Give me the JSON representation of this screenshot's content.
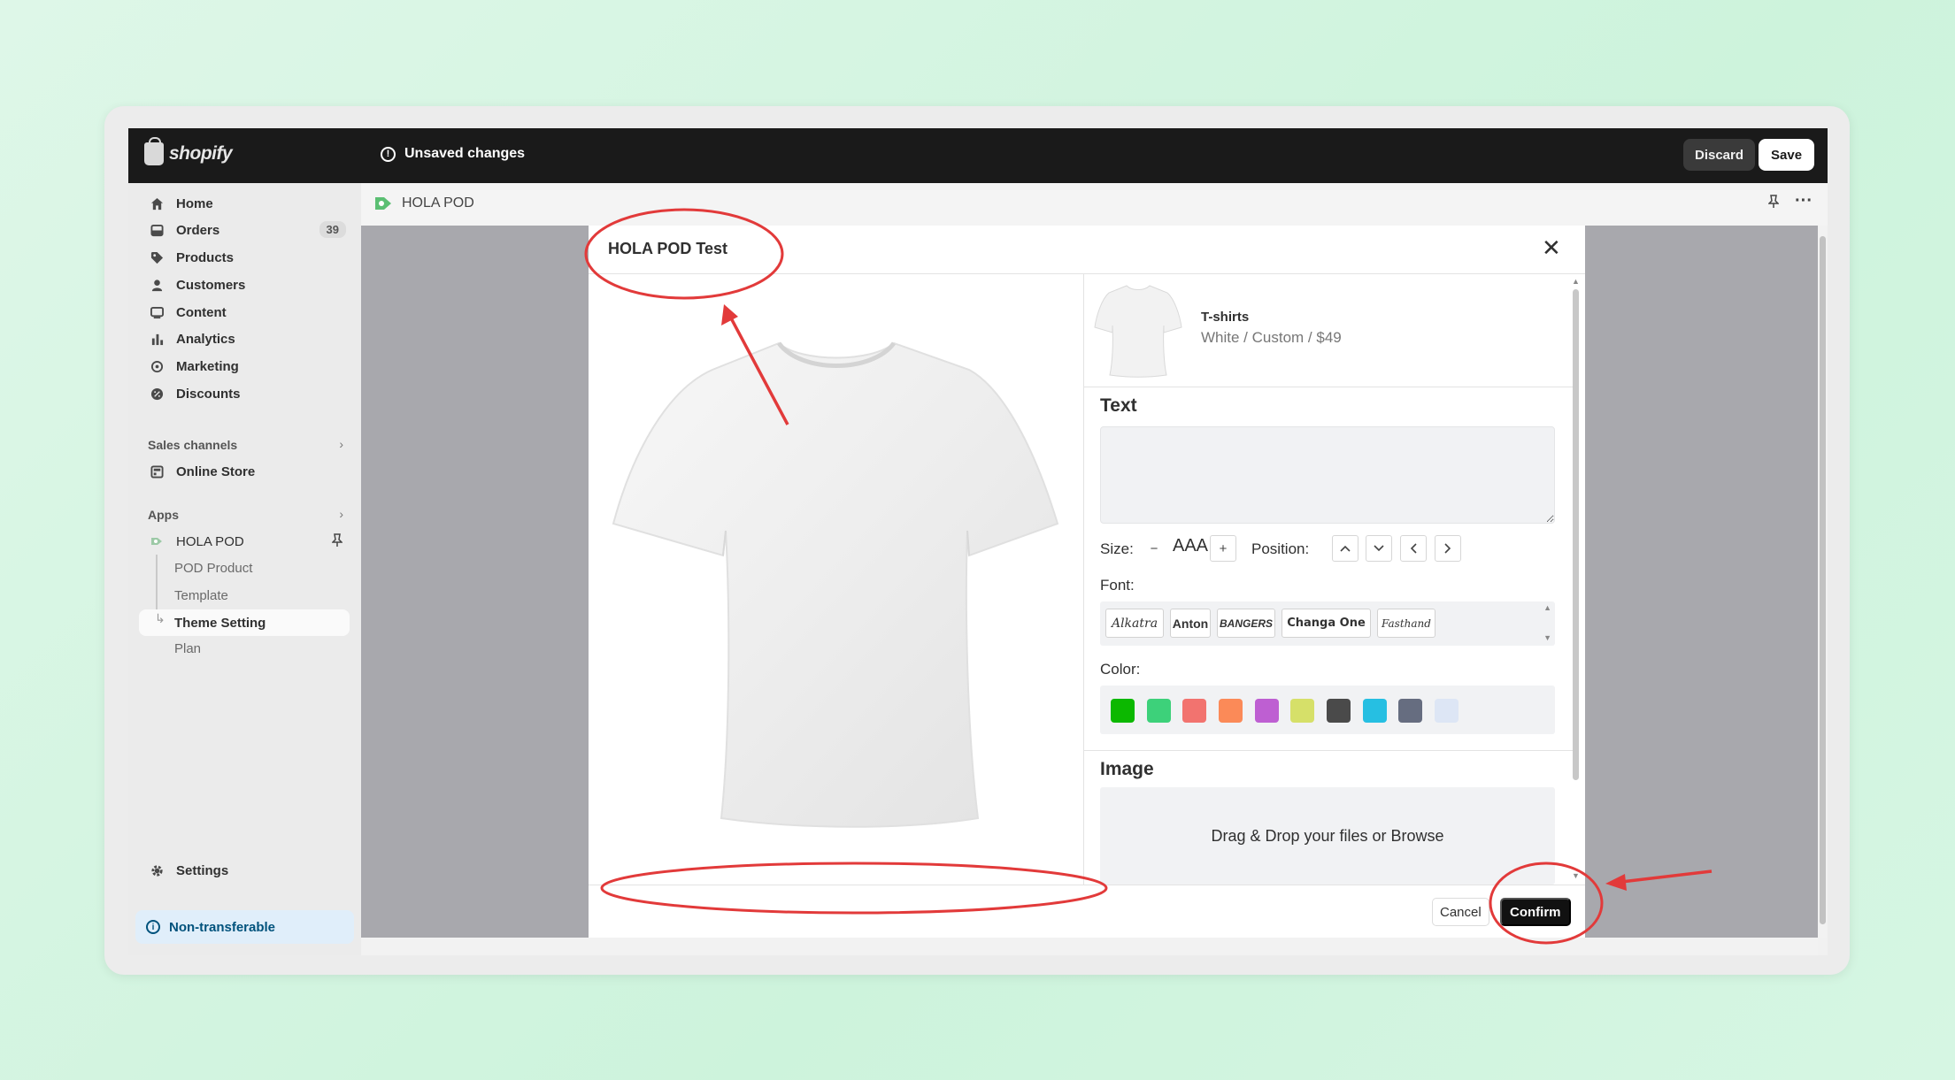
{
  "topbar": {
    "logo_text": "shopify",
    "status_text": "Unsaved changes",
    "discard_label": "Discard",
    "save_label": "Save"
  },
  "sidebar": {
    "items": [
      {
        "label": "Home",
        "icon": "home-icon"
      },
      {
        "label": "Orders",
        "icon": "inbox-icon",
        "badge": "39"
      },
      {
        "label": "Products",
        "icon": "tag-icon"
      },
      {
        "label": "Customers",
        "icon": "person-icon"
      },
      {
        "label": "Content",
        "icon": "image-icon"
      },
      {
        "label": "Analytics",
        "icon": "bar-chart-icon"
      },
      {
        "label": "Marketing",
        "icon": "target-icon"
      },
      {
        "label": "Discounts",
        "icon": "discount-icon"
      }
    ],
    "sales_channels_label": "Sales channels",
    "online_store_label": "Online Store",
    "apps_label": "Apps",
    "app_name": "HOLA POD",
    "app_sub_items": [
      "POD Product",
      "Template",
      "Theme Setting",
      "Plan"
    ],
    "settings_label": "Settings",
    "non_transferable_label": "Non-transferable"
  },
  "main": {
    "app_title": "HOLA POD"
  },
  "modal": {
    "title": "HOLA POD Test",
    "close_icon": "close-icon",
    "product": {
      "name": "T-shirts",
      "variant": "White / Custom / $49"
    },
    "text_heading": "Text",
    "text_value": "",
    "size_label": "Size:",
    "size_minus": "−",
    "size_value": "AAA",
    "size_plus": "+",
    "position_label": "Position:",
    "font_label": "Font:",
    "fonts": [
      "Alkatra",
      "Anton",
      "BANGERS",
      "Changa One",
      "Fasthand"
    ],
    "color_label": "Color:",
    "colors": [
      "#0cb800",
      "#3dd17a",
      "#f2736f",
      "#fb8a58",
      "#be5fd2",
      "#d6e069",
      "#4a4a4a",
      "#26bfe2",
      "#666d80",
      "#dde6f5"
    ],
    "image_heading": "Image",
    "drop_text": "Drag & Drop your files or Browse",
    "cancel_label": "Cancel",
    "confirm_label": "Confirm"
  },
  "accent_colors": {
    "annotation": "#e23a3a",
    "topbar": "#1a1a1a",
    "confirm": "#111111"
  }
}
